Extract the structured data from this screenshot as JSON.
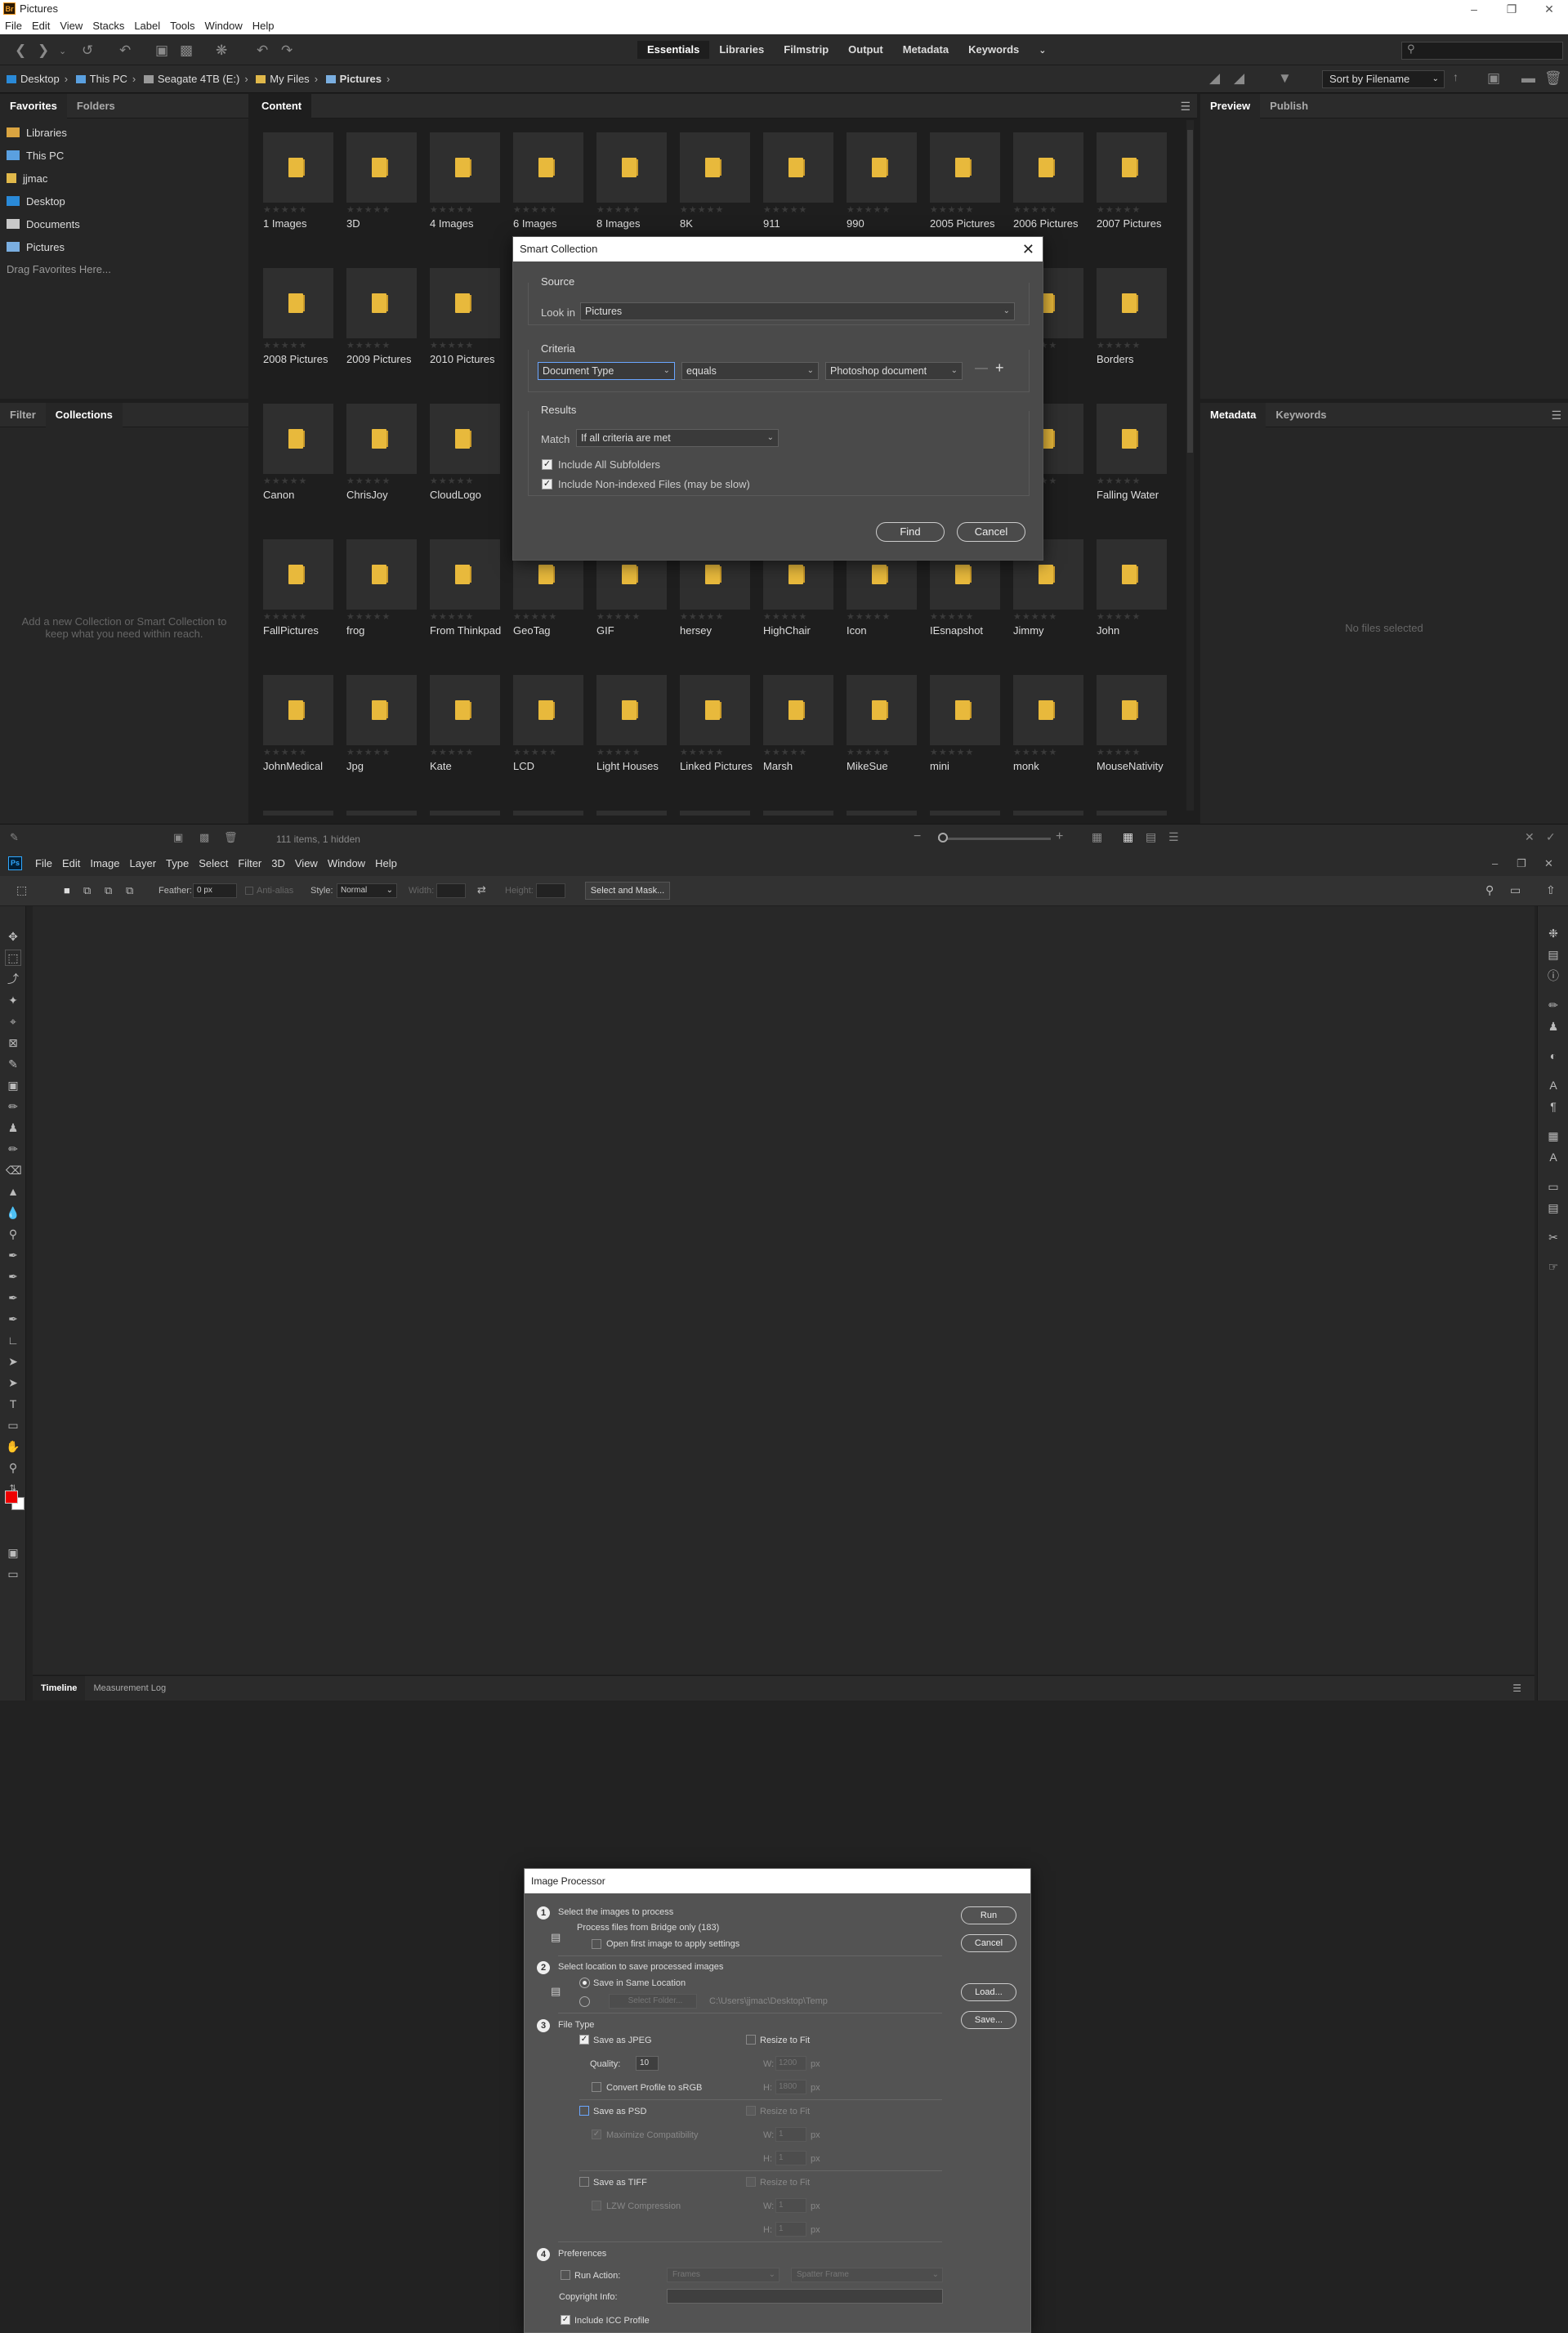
{
  "bridge": {
    "window_title": "Pictures",
    "menu": [
      "File",
      "Edit",
      "View",
      "Stacks",
      "Label",
      "Tools",
      "Window",
      "Help"
    ],
    "workspaces": [
      "Essentials",
      "Libraries",
      "Filmstrip",
      "Output",
      "Metadata",
      "Keywords"
    ],
    "active_workspace": "Essentials",
    "search_placeholder": "",
    "breadcrumb": [
      "Desktop",
      "This PC",
      "Seagate 4TB (E:)",
      "My Files",
      "Pictures"
    ],
    "sort_label": "Sort by Filename",
    "favorites_tabs": [
      "Favorites",
      "Folders"
    ],
    "favorites": [
      {
        "label": "Libraries",
        "icon_color": "#d9a441"
      },
      {
        "label": "This PC",
        "icon_color": "#5aa0e0"
      },
      {
        "label": "jjmac",
        "icon_color": "#e0b84a"
      },
      {
        "label": "Desktop",
        "icon_color": "#2a8ad8"
      },
      {
        "label": "Documents",
        "icon_color": "#c8c8c8"
      },
      {
        "label": "Pictures",
        "icon_color": "#7aaee0"
      }
    ],
    "favorites_hint": "Drag Favorites Here...",
    "collections_tabs": [
      "Filter",
      "Collections"
    ],
    "collections_message": "Add a new Collection or Smart Collection to keep what you need within reach.",
    "content_tab": "Content",
    "preview_tabs": [
      "Preview",
      "Publish"
    ],
    "metadata_tabs": [
      "Metadata",
      "Keywords"
    ],
    "no_files": "No files selected",
    "status": "111 items, 1 hidden",
    "thumb_rows": [
      [
        "1 Images",
        "3D",
        "4 Images",
        "6 Images",
        "8 Images",
        "8K",
        "911",
        "990",
        "2005 Pictures",
        "2006 Pictures",
        "2007 Pictures"
      ],
      [
        "2008 Pictures",
        "2009 Pictures",
        "2010 Pictures",
        "",
        "",
        "",
        "",
        "",
        "",
        "",
        "Borders"
      ],
      [
        "Canon",
        "ChrisJoy",
        "CloudLogo",
        "",
        "",
        "",
        "",
        "",
        "",
        "",
        "Falling Water"
      ],
      [
        "FallPictures",
        "frog",
        "From Thinkpad",
        "GeoTag",
        "GIF",
        "hersey",
        "HighChair",
        "Icon",
        "IEsnapshot",
        "Jimmy",
        "John"
      ],
      [
        "JohnMedical",
        "Jpg",
        "Kate",
        "LCD",
        "Light Houses",
        "Linked Pictures",
        "Marsh",
        "MikeSue",
        "mini",
        "monk",
        "MouseNativity"
      ]
    ]
  },
  "smart_collection": {
    "title": "Smart Collection",
    "source_label": "Source",
    "look_in_label": "Look in",
    "look_in_value": "Pictures",
    "criteria_label": "Criteria",
    "criteria_field": "Document Type",
    "criteria_op": "equals",
    "criteria_value": "Photoshop document",
    "results_label": "Results",
    "match_label": "Match",
    "match_value": "If all criteria are met",
    "include_subfolders": "Include All Subfolders",
    "include_nonindexed": "Include Non-indexed Files (may be slow)",
    "find": "Find",
    "cancel": "Cancel"
  },
  "photoshop": {
    "menu": [
      "File",
      "Edit",
      "Image",
      "Layer",
      "Type",
      "Select",
      "Filter",
      "3D",
      "View",
      "Window",
      "Help"
    ],
    "feather_label": "Feather:",
    "feather_value": "0 px",
    "antialias_label": "Anti-alias",
    "style_label": "Style:",
    "style_value": "Normal",
    "width_label": "Width:",
    "height_label": "Height:",
    "select_mask": "Select and Mask...",
    "timeline_tabs": [
      "Timeline",
      "Measurement Log"
    ],
    "foreground_color": "#e00000",
    "background_color": "#ffffff"
  },
  "image_processor": {
    "title": "Image Processor",
    "step1": "Select the images to process",
    "step1_detail": "Process files from Bridge only (183)",
    "open_first": "Open first image to apply settings",
    "step2": "Select location to save processed images",
    "save_same": "Save in Same Location",
    "select_folder": "Select Folder...",
    "folder_path": "C:\\Users\\jjmac\\Desktop\\Temp",
    "step3": "File Type",
    "save_jpeg": "Save as JPEG",
    "resize_fit": "Resize to Fit",
    "quality_label": "Quality:",
    "quality_value": "10",
    "w_label": "W:",
    "h_label": "H:",
    "px": "px",
    "jpeg_w": "1200",
    "jpeg_h": "1800",
    "convert_srgb": "Convert Profile to sRGB",
    "save_psd": "Save as PSD",
    "max_compat": "Maximize Compatibility",
    "psd_w": "1",
    "psd_h": "1",
    "save_tiff": "Save as TIFF",
    "lzw": "LZW Compression",
    "tiff_w": "1",
    "tiff_h": "1",
    "step4": "Preferences",
    "run_action": "Run Action:",
    "action_set": "Frames",
    "action_name": "Spatter Frame",
    "copyright": "Copyright Info:",
    "icc": "Include ICC Profile",
    "run": "Run",
    "cancel": "Cancel",
    "load": "Load...",
    "save": "Save..."
  }
}
